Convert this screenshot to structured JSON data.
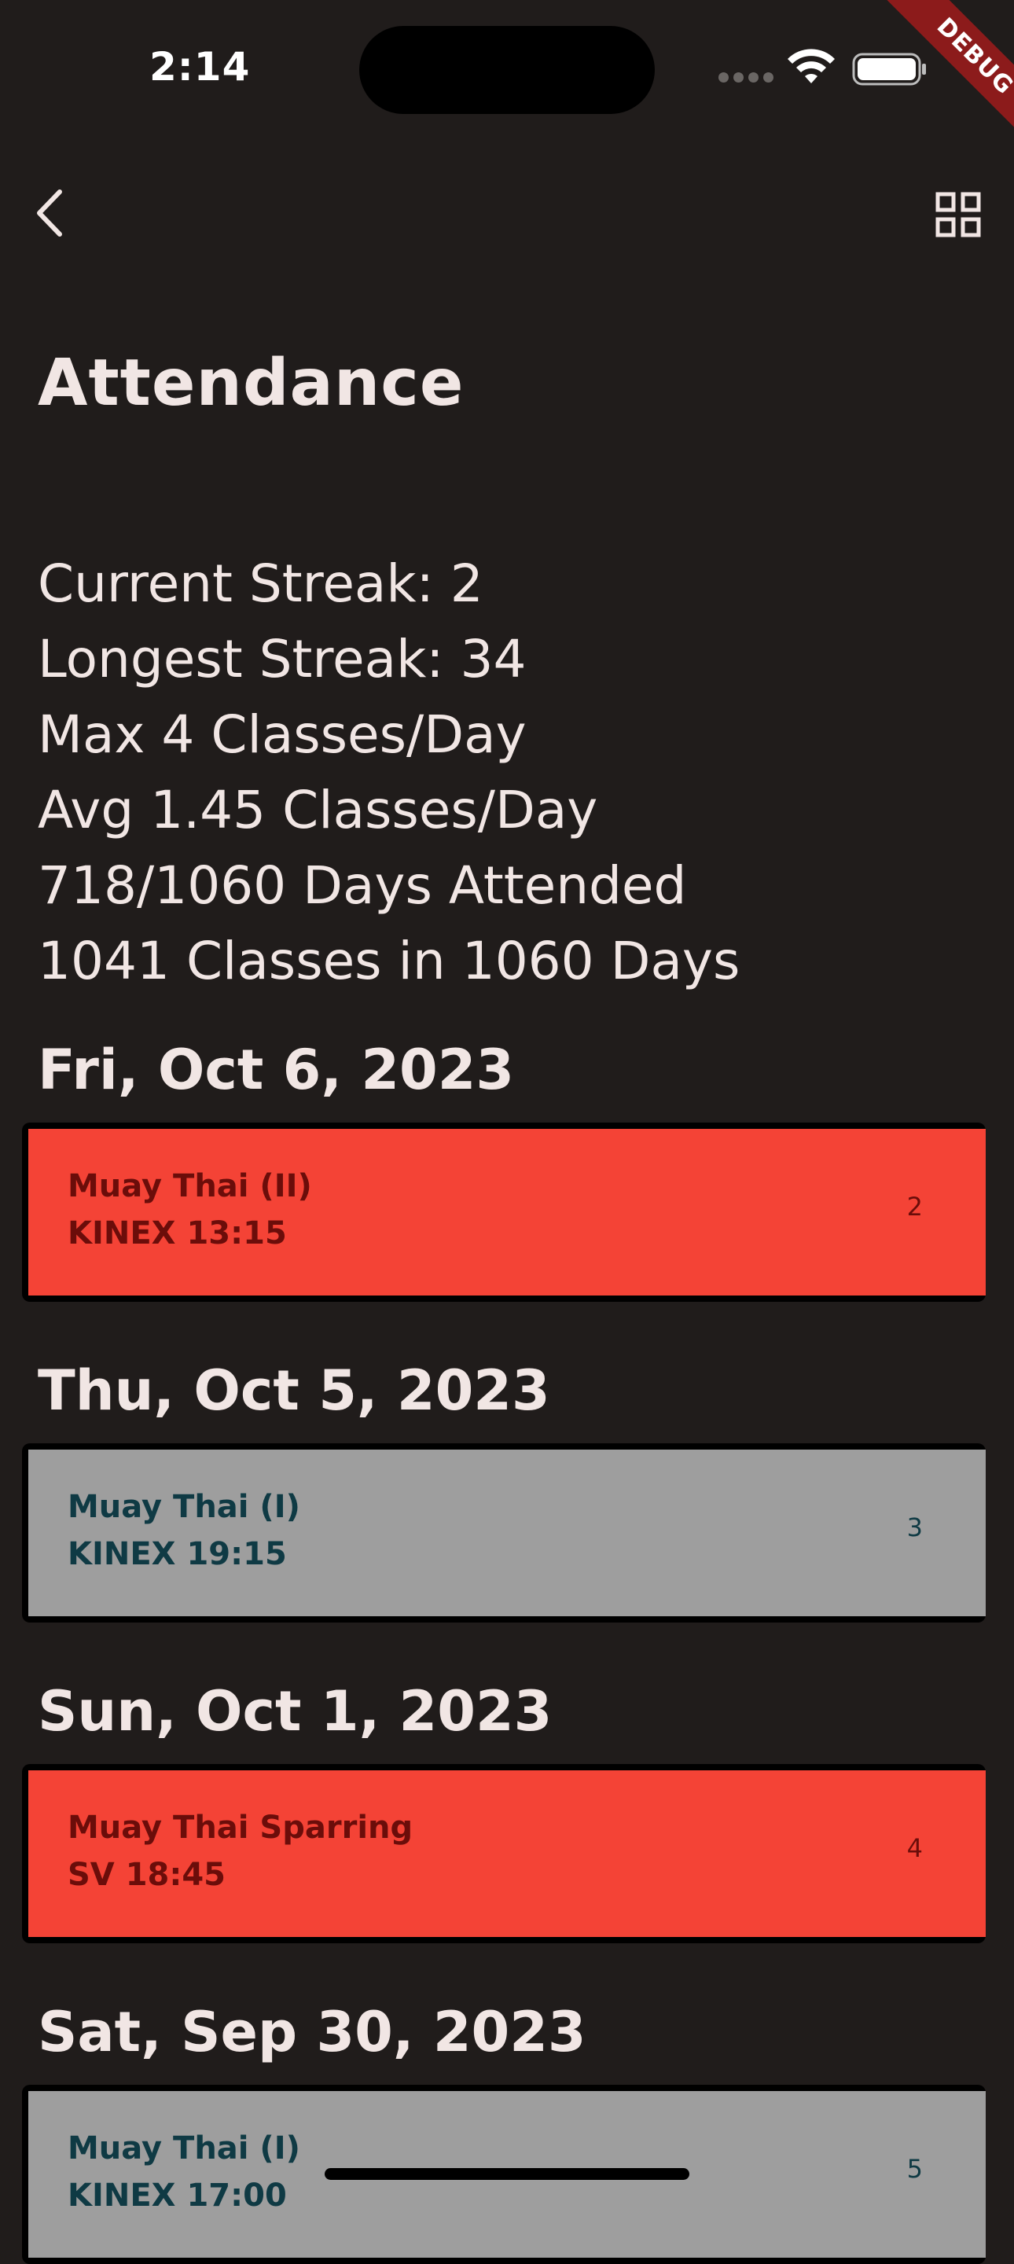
{
  "status_bar": {
    "time": "2:14",
    "debug_label": "DEBUG"
  },
  "page": {
    "title": "Attendance"
  },
  "stats": [
    "Current Streak: 2",
    "Longest Streak: 34",
    "Max 4 Classes/Day",
    "Avg 1.45 Classes/Day",
    "718/1060 Days Attended",
    "1041 Classes in 1060 Days"
  ],
  "entries": [
    {
      "date": "Fri, Oct 6, 2023",
      "class_name": "Muay Thai (II)",
      "location_time": "KINEX 13:15",
      "number": "2",
      "color": "#f44336"
    },
    {
      "date": "Thu, Oct 5, 2023",
      "class_name": "Muay Thai (I)",
      "location_time": "KINEX 19:15",
      "number": "3",
      "color": "#9e9e9e"
    },
    {
      "date": "Sun, Oct 1, 2023",
      "class_name": "Muay Thai Sparring",
      "location_time": "SV 18:45",
      "number": "4",
      "color": "#f44336"
    },
    {
      "date": "Sat, Sep 30, 2023",
      "class_name": "Muay Thai (I)",
      "location_time": "KINEX 17:00",
      "number": "5",
      "color": "#9e9e9e"
    }
  ],
  "icons": {
    "back": "chevron-left-icon",
    "grid": "grid-view-icon",
    "wifi": "wifi-icon",
    "battery": "battery-icon"
  }
}
